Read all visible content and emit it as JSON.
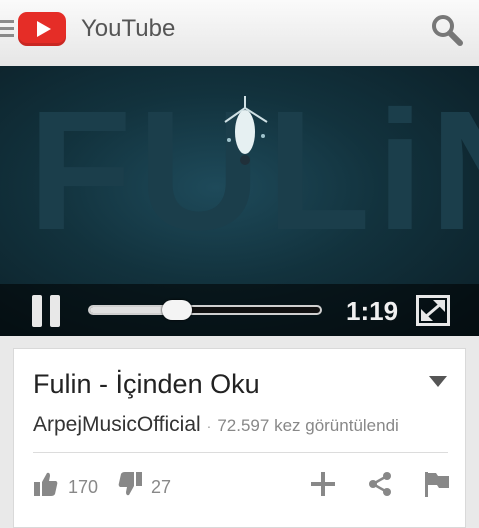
{
  "appbar": {
    "title": "YouTube",
    "icons": [
      "menu-icon",
      "youtube-logo-icon",
      "search-icon"
    ],
    "brand_color": "#e52d27"
  },
  "player": {
    "watermark_text": "FULiN",
    "current_time": "1:19",
    "progress_fraction": 0.38,
    "state": "playing",
    "icons": [
      "pause-icon",
      "fullscreen-icon"
    ]
  },
  "video": {
    "title": "Fulin - İçinden Oku",
    "channel": "ArpejMusicOfficial",
    "separator": "·",
    "views": "72.597 kez görüntülendi",
    "likes": "170",
    "dislikes": "27",
    "icons": [
      "chevron-down-icon",
      "thumbs-up-icon",
      "thumbs-down-icon",
      "add-icon",
      "share-icon",
      "flag-icon"
    ]
  }
}
